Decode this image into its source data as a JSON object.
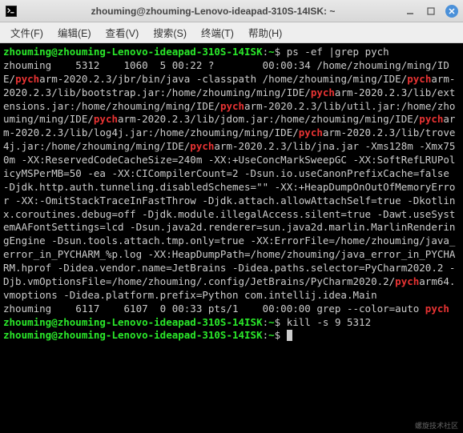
{
  "window": {
    "title": "zhouming@zhouming-Lenovo-ideapad-310S-14ISK: ~"
  },
  "menu": {
    "file": "文件(F)",
    "edit": "编辑(E)",
    "view": "查看(V)",
    "search": "搜索(S)",
    "terminal": "终端(T)",
    "help": "帮助(H)"
  },
  "prompts": {
    "p1_userhost": "zhouming@zhouming-Lenovo-ideapad-310S-14ISK",
    "p1_cwd": "~",
    "p2_userhost": "zhouming@zhouming-Lenovo-ideapad-310S-14ISK",
    "p2_cwd": "~",
    "p3_userhost": "zhouming@zhouming-Lenovo-ideapad-310S-14ISK",
    "p3_cwd": "~"
  },
  "commands": {
    "cmd1": "ps -ef |grep pych",
    "cmd2": "kill -s 9 5312",
    "cmd3": ""
  },
  "ps_output": {
    "line1_pre": "zhouming    5312    1060  5 00:22 ?        00:00:34 /home/zhouming/ming/IDE/",
    "hi1": "pych",
    "line2_a": "arm-2020.2.3/jbr/bin/java -classpath /home/zhouming/ming/IDE/",
    "hi2": "pych",
    "line2_b": "arm-2020.2.3/lib/bootstrap.jar:/home/zhouming/ming/IDE/",
    "hi3": "pych",
    "line2_c": "arm-2020.2.3/lib/extensions.jar:/home/zhouming/ming/IDE/",
    "hi4": "pych",
    "line2_d": "arm-2020.2.3/lib/util.jar:/home/zhouming/ming/IDE/",
    "hi5": "pych",
    "line2_e": "arm-2020.2.3/lib/jdom.jar:/home/zhouming/ming/IDE/",
    "hi6": "pych",
    "line2_f": "arm-2020.2.3/lib/log4j.jar:/home/zhouming/ming/IDE/",
    "hi7": "pych",
    "line2_g": "arm-2020.2.3/lib/trove4j.jar:/home/zhouming/ming/IDE/",
    "hi8": "pych",
    "line2_h": "arm-2020.2.3/lib/jna.jar -Xms128m -Xmx750m -XX:ReservedCodeCacheSize=240m -XX:+UseConcMarkSweepGC -XX:SoftRefLRUPolicyMSPerMB=50 -ea -XX:CICompilerCount=2 -Dsun.io.useCanonPrefixCache=false -Djdk.http.auth.tunneling.disabledSchemes=\"\" -XX:+HeapDumpOnOutOfMemoryError -XX:-OmitStackTraceInFastThrow -Djdk.attach.allowAttachSelf=true -Dkotlinx.coroutines.debug=off -Djdk.module.illegalAccess.silent=true -Dawt.useSystemAAFontSettings=lcd -Dsun.java2d.renderer=sun.java2d.marlin.MarlinRenderingEngine -Dsun.tools.attach.tmp.only=true -XX:ErrorFile=/home/zhouming/java_error_in_PYCHARM_%p.log -XX:HeapDumpPath=/home/zhouming/java_error_in_PYCHARM.hprof -Didea.vendor.name=JetBrains -Didea.paths.selector=PyCharm2020.2 -Djb.vmOptionsFile=/home/zhouming/.config/JetBrains/PyCharm2020.2/",
    "hi9": "pych",
    "line2_i": "arm64.vmoptions -Didea.platform.prefix=Python com.intellij.idea.Main",
    "line3_a": "zhouming    6117    6107  0 00:33 pts/1    00:00:00 grep --color=auto ",
    "hi10": "pych"
  },
  "watermark": "螺旋技术社区"
}
